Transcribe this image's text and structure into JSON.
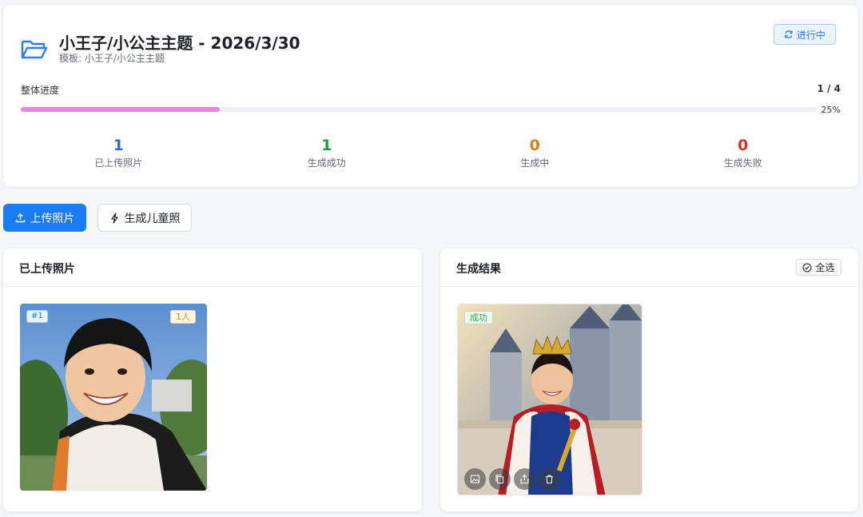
{
  "task": {
    "title": "小王子/小公主主题 - 2026/3/30",
    "template_line": "模板: 小王子/小公主主题",
    "status": "进行中"
  },
  "progress": {
    "label": "整体进度",
    "count": "1 / 4",
    "percent_text": "25%",
    "fraction": 0.25
  },
  "stats": [
    {
      "value": "1",
      "label": "已上传照片",
      "color": "#2e6fd8"
    },
    {
      "value": "1",
      "label": "生成成功",
      "color": "#1e9b4e"
    },
    {
      "value": "0",
      "label": "生成中",
      "color": "#e0781e"
    },
    {
      "value": "0",
      "label": "生成失败",
      "color": "#d93026"
    }
  ],
  "buttons": {
    "upload": "上传照片",
    "generate": "生成儿童照"
  },
  "uploaded": {
    "title": "已上传照片",
    "photo_tag": "#1",
    "people_tag": "1人"
  },
  "results": {
    "title": "生成结果",
    "select_all": "全选",
    "status_tag": "成功"
  },
  "colors": {
    "primary": "#1a7cf5",
    "progress_fill": "#ee82e1"
  },
  "icons": [
    "folder-open-icon",
    "sync-icon",
    "upload-icon",
    "lightning-icon",
    "check-circle-icon",
    "image-icon",
    "copy-icon",
    "share-icon",
    "delete-icon"
  ]
}
